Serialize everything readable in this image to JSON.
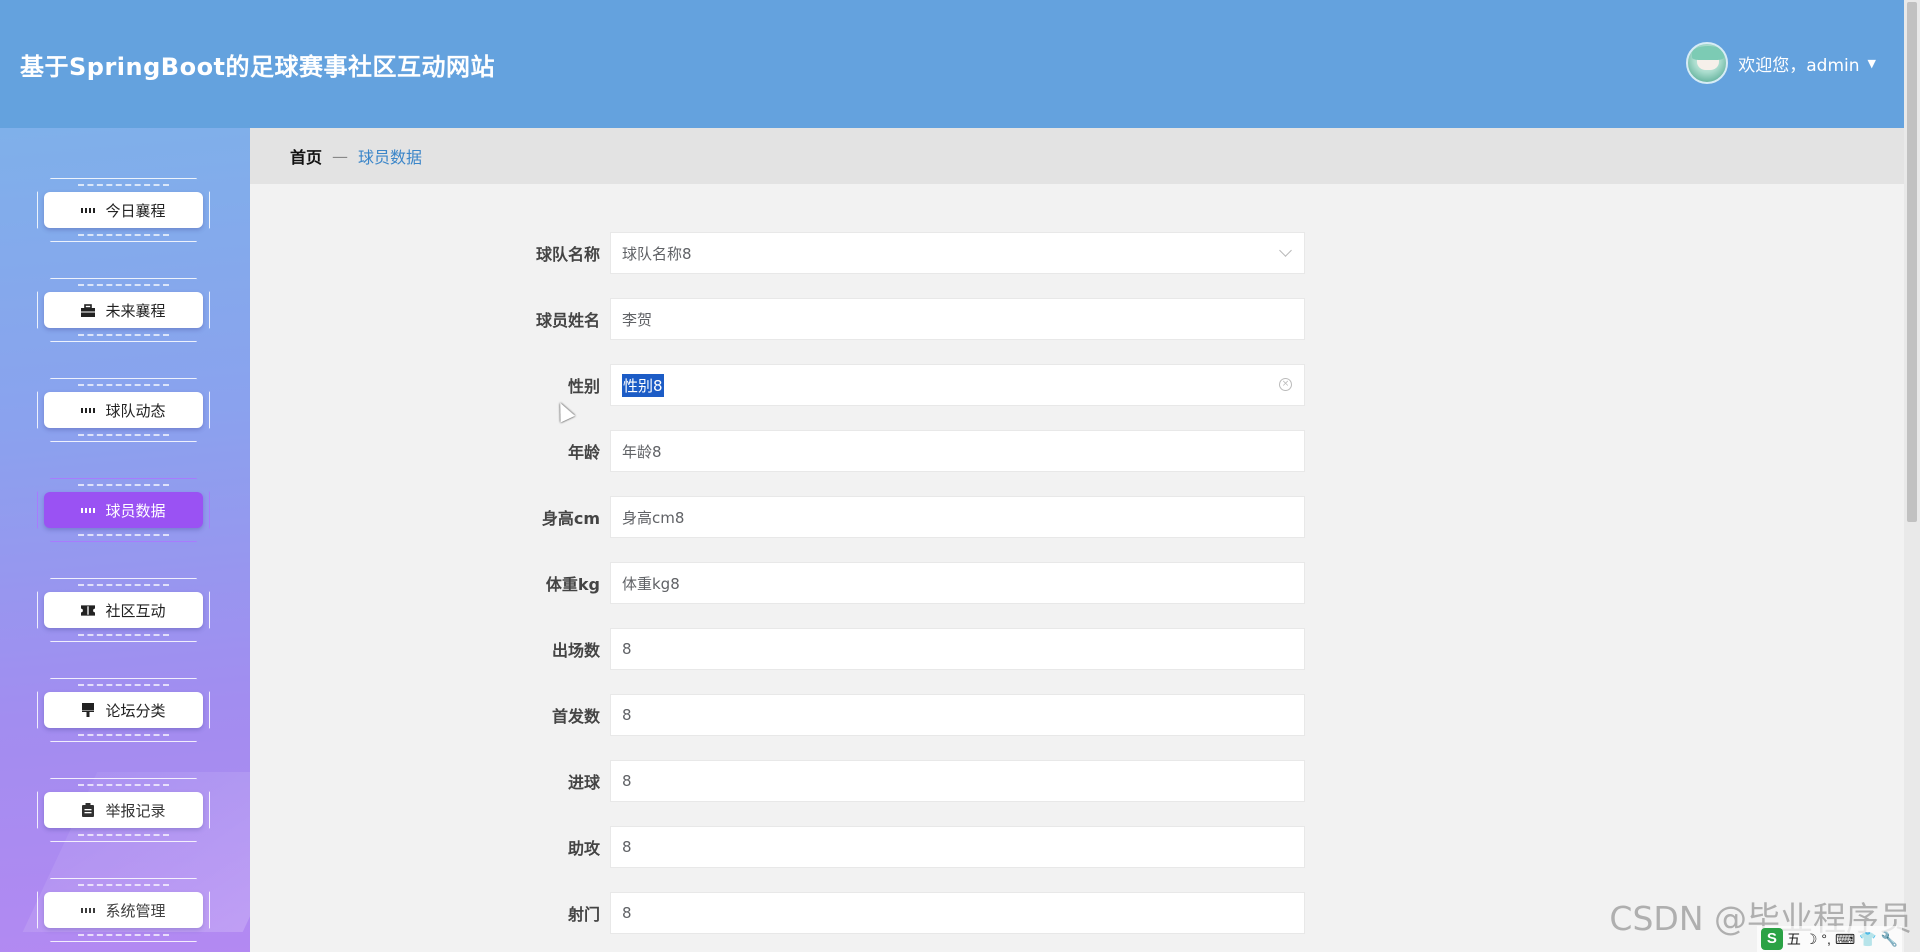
{
  "header": {
    "title": "基于SpringBoot的足球赛事社区互动网站",
    "welcome": "欢迎您，admin"
  },
  "sidebar": {
    "items": [
      {
        "label": "今日襄程",
        "icon": "grid-icon"
      },
      {
        "label": "未来襄程",
        "icon": "briefcase-icon"
      },
      {
        "label": "球队动态",
        "icon": "grid-icon"
      },
      {
        "label": "球员数据",
        "icon": "grid-icon",
        "active": true
      },
      {
        "label": "社区互动",
        "icon": "ticket-icon"
      },
      {
        "label": "论坛分类",
        "icon": "brush-icon"
      },
      {
        "label": "举报记录",
        "icon": "clipboard-icon"
      },
      {
        "label": "系统管理",
        "icon": "grid-icon"
      }
    ]
  },
  "breadcrumb": {
    "home": "首页",
    "separator": "—",
    "current": "球员数据"
  },
  "form": {
    "fields": [
      {
        "label": "球队名称",
        "value": "球队名称8",
        "type": "select"
      },
      {
        "label": "球员姓名",
        "value": "李贺",
        "type": "input"
      },
      {
        "label": "性别",
        "value": "性别8",
        "type": "input-selected"
      },
      {
        "label": "年龄",
        "value": "年龄8",
        "type": "input"
      },
      {
        "label": "身高cm",
        "value": "身高cm8",
        "type": "input"
      },
      {
        "label": "体重kg",
        "value": "体重kg8",
        "type": "input"
      },
      {
        "label": "出场数",
        "value": "8",
        "type": "input"
      },
      {
        "label": "首发数",
        "value": "8",
        "type": "input"
      },
      {
        "label": "进球",
        "value": "8",
        "type": "input"
      },
      {
        "label": "助攻",
        "value": "8",
        "type": "input"
      },
      {
        "label": "射门",
        "value": "8",
        "type": "input"
      }
    ]
  },
  "watermark": "CSDN @毕业程序员",
  "tray": {
    "logo": "S",
    "ime": "五"
  },
  "colors": {
    "header": "#64a2de",
    "active_menu": "#9a52f3",
    "breadcrumb_link": "#3b86c9"
  }
}
